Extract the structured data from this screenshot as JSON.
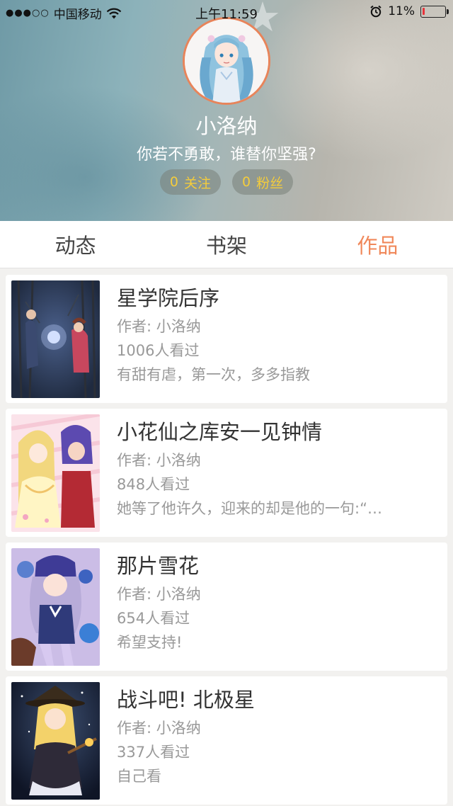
{
  "status_bar": {
    "carrier": "中国移动",
    "signal": "●●●○○",
    "time": "上午11:59",
    "battery": "11%",
    "battery_level": 0.11
  },
  "profile": {
    "username": "小洛纳",
    "signature": "你若不勇敢，谁替你坚强?",
    "follow_count": "0",
    "follow_label": "关注",
    "fans_count": "0",
    "fans_label": "粉丝"
  },
  "tabs": [
    {
      "label": "动态",
      "active": false
    },
    {
      "label": "书架",
      "active": false
    },
    {
      "label": "作品",
      "active": true
    }
  ],
  "works": [
    {
      "title": "星学院后序",
      "author": "作者: 小洛纳",
      "views": "1006人看过",
      "desc": "有甜有虐，第一次，多多指教"
    },
    {
      "title": "小花仙之库安一见钟情",
      "author": "作者: 小洛纳",
      "views": "848人看过",
      "desc": "她等了他许久，迎来的却是他的一句:“…"
    },
    {
      "title": "那片雪花",
      "author": "作者: 小洛纳",
      "views": "654人看过",
      "desc": "希望支持!"
    },
    {
      "title": "战斗吧! 北极星",
      "author": "作者: 小洛纳",
      "views": "337人看过",
      "desc": "自己看"
    }
  ],
  "colors": {
    "accent": "#f0885a",
    "stat_text": "#f4cc3c",
    "battery_low": "#e8323a"
  }
}
